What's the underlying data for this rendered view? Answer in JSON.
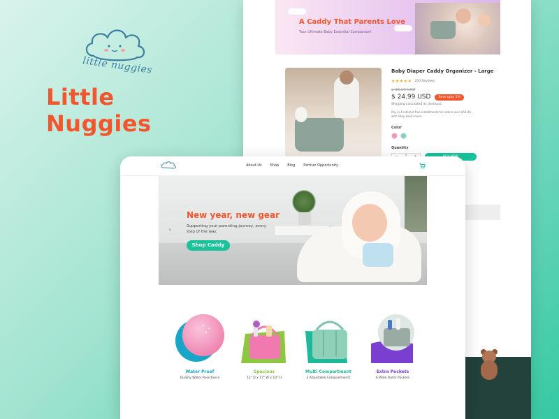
{
  "brand": {
    "name": "Little Nuggies",
    "logo_text": "little nuggies"
  },
  "product_page": {
    "promo": {
      "title": "A Caddy That Parents Love",
      "subtitle": "Your Ultimate Baby Essential Companion!"
    },
    "product": {
      "title": "Baby Diaper Caddy Organizer - Large",
      "stars": "★★★★★",
      "reviews": "200 Reviews",
      "old_price": "$ 36.00 USD",
      "price": "$ 24.99 USD",
      "save_badge": "Save upto 5%",
      "shipping": "Shipping calculated at checkout.",
      "pay_line_1": "Pay in 4 interest-free installments for orders over $50.00",
      "pay_line_2": "with shop Learn more",
      "color_label": "Color",
      "colors": [
        "#f78fbf",
        "#7fd3c1"
      ],
      "quantity_label": "Quantity",
      "qty_minus": "−",
      "qty_value": "1",
      "qty_plus": "+",
      "buy_now": "BUY NOW"
    }
  },
  "home": {
    "nav": {
      "links": [
        "About Us",
        "Shop",
        "Blog",
        "Partner Opportunity"
      ],
      "cart_icon": "cart-icon"
    },
    "hero": {
      "headline": "New year, new gear",
      "subtext": "Supporting your parenting journey, every step of the way.",
      "cta": "Shop Caddy",
      "prev_arrow": "‹"
    },
    "features": [
      {
        "title": "Water Proof",
        "desc": "Quality Water Resistance",
        "color": "#1aa4c8"
      },
      {
        "title": "Spacious",
        "desc": "12\" D x 17\" W x 10\" H",
        "color": "#8dc63f"
      },
      {
        "title": "Multi Compartment",
        "desc": "3 Adjustable Compartments",
        "color": "#1fb89a"
      },
      {
        "title": "Extra Pockets",
        "desc": "6 Wide Outer Pockets",
        "color": "#7a3fd1"
      }
    ]
  }
}
